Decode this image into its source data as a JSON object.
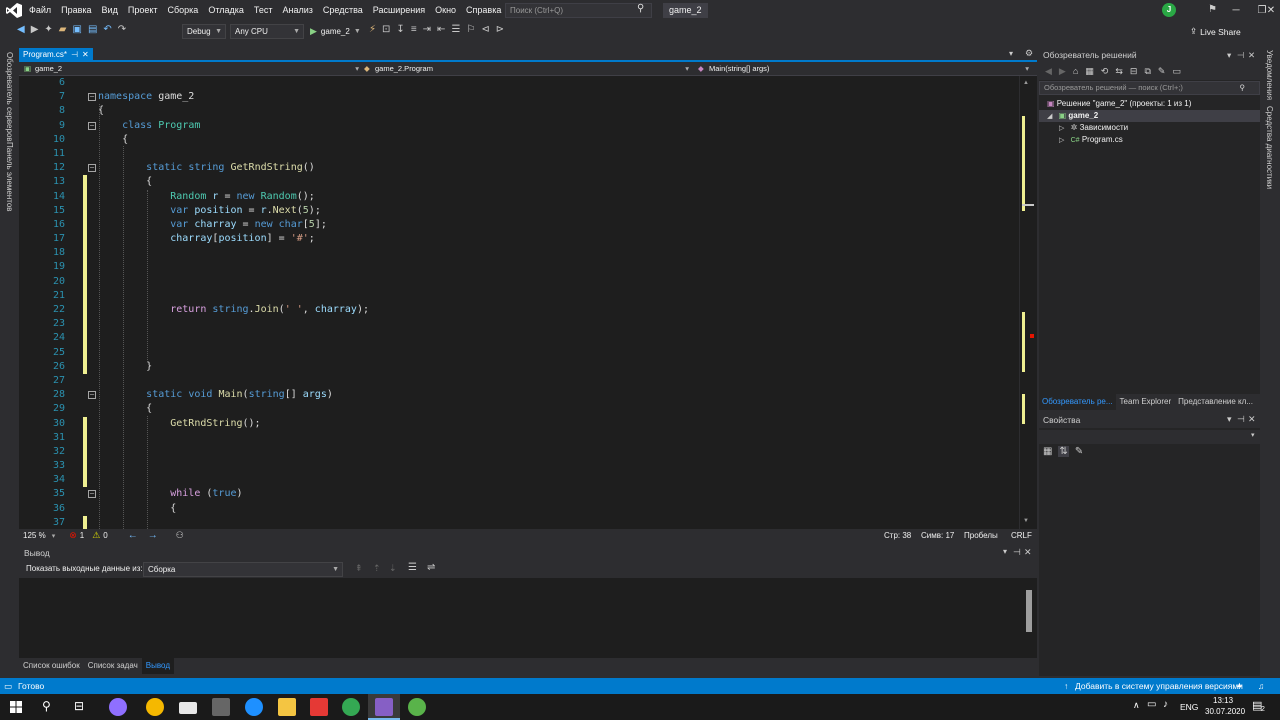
{
  "menu": [
    "Файл",
    "Правка",
    "Вид",
    "Проект",
    "Сборка",
    "Отладка",
    "Тест",
    "Анализ",
    "Средства",
    "Расширения",
    "Окно",
    "Справка"
  ],
  "search": {
    "placeholder": "Поиск (Ctrl+Q)"
  },
  "solution_title": "game_2",
  "user_initial": "J",
  "toolbar": {
    "config": "Debug",
    "platform": "Any CPU",
    "run_label": "game_2",
    "live_share": "Live Share"
  },
  "left_strip": [
    "Обозреватель серверов",
    "Панель элементов"
  ],
  "right_strip": [
    "Уведомления",
    "Средства диагностики"
  ],
  "doc_tab": {
    "label": "Program.cs*",
    "pin": "⊣",
    "close": "✕"
  },
  "navbar": {
    "project": "game_2",
    "class": "game_2.Program",
    "member": "Main(string[] args)"
  },
  "code_lines": [
    {
      "n": "6",
      "t": ""
    },
    {
      "n": "7",
      "t": "<span class='kw'>namespace</span> game_2",
      "fold": true
    },
    {
      "n": "8",
      "t": "{"
    },
    {
      "n": "9",
      "t": "    <span class='kw'>class</span> <span class='ty'>Program</span>",
      "fold": true
    },
    {
      "n": "10",
      "t": "    {"
    },
    {
      "n": "11",
      "t": ""
    },
    {
      "n": "12",
      "t": "        <span class='kw'>static</span> <span class='kw'>string</span> <span class='fn'>GetRndString</span>()",
      "fold": true
    },
    {
      "n": "13",
      "t": "        {",
      "chg": true
    },
    {
      "n": "14",
      "t": "            <span class='ty'>Random</span> <span class='vr'>r</span> = <span class='kw'>new</span> <span class='ty'>Random</span>();",
      "chg": true
    },
    {
      "n": "15",
      "t": "            <span class='kw'>var</span> <span class='vr'>position</span> = <span class='vr'>r</span>.<span class='fn'>Next</span>(<span class='nm'>5</span>);",
      "chg": true
    },
    {
      "n": "16",
      "t": "            <span class='kw'>var</span> <span class='vr'>charray</span> = <span class='kw'>new</span> <span class='kw'>char</span>[<span class='nm'>5</span>];",
      "chg": true
    },
    {
      "n": "17",
      "t": "            <span class='vr'>charray</span>[<span class='vr'>position</span>] = <span class='st'>'#'</span>;",
      "chg": true
    },
    {
      "n": "18",
      "t": "",
      "chg": true
    },
    {
      "n": "19",
      "t": "",
      "chg": true
    },
    {
      "n": "20",
      "t": "",
      "chg": true
    },
    {
      "n": "21",
      "t": "",
      "chg": true
    },
    {
      "n": "22",
      "t": "            <span class='kc'>return</span> <span class='kw'>string</span>.<span class='fn'>Join</span>(<span class='st'>' '</span>, <span class='vr'>charray</span>);",
      "chg": true
    },
    {
      "n": "23",
      "t": "",
      "chg": true
    },
    {
      "n": "24",
      "t": "",
      "chg": true
    },
    {
      "n": "25",
      "t": "",
      "chg": true
    },
    {
      "n": "26",
      "t": "        }",
      "chg": true
    },
    {
      "n": "27",
      "t": ""
    },
    {
      "n": "28",
      "t": "        <span class='kw'>static</span> <span class='kw'>void</span> <span class='fn'>Main</span>(<span class='kw'>string</span>[] <span class='vr'>args</span>)",
      "fold": true
    },
    {
      "n": "29",
      "t": "        {"
    },
    {
      "n": "30",
      "t": "            <span class='fn'>GetRndString</span>();",
      "chg": true
    },
    {
      "n": "31",
      "t": "",
      "chg": true
    },
    {
      "n": "32",
      "t": "",
      "chg": true
    },
    {
      "n": "33",
      "t": "",
      "chg": true
    },
    {
      "n": "34",
      "t": "",
      "chg": true
    },
    {
      "n": "35",
      "t": "            <span class='kc'>while</span> (<span class='kw'>true</span>)",
      "fold": true
    },
    {
      "n": "36",
      "t": "            {"
    },
    {
      "n": "37",
      "t": "",
      "chg": true
    }
  ],
  "editor_status": {
    "zoom": "125 %",
    "errors": "1",
    "warnings": "0",
    "line": "Стр: 38",
    "col": "Симв: 17",
    "spaces": "Пробелы",
    "eol": "CRLF"
  },
  "output": {
    "title": "Вывод",
    "show_label": "Показать выходные данные из:",
    "source": "Сборка"
  },
  "bottom_tabs": [
    "Список ошибок",
    "Список задач",
    "Вывод"
  ],
  "solution_explorer": {
    "title": "Обозреватель решений",
    "search_placeholder": "Обозреватель решений — поиск (Ctrl+;)",
    "solution": "Решение \"game_2\" (проекты: 1 из 1)",
    "project": "game_2",
    "deps": "Зависимости",
    "file": "Program.cs",
    "tabs": [
      "Обозреватель ре...",
      "Team Explorer",
      "Представление кл..."
    ]
  },
  "properties": {
    "title": "Свойства"
  },
  "statusbar": {
    "ready": "Готово",
    "vcs": "Добавить в систему управления версиями"
  },
  "taskbar": {
    "lang": "ENG",
    "time": "13:13",
    "date": "30.07.2020",
    "notif": "2"
  },
  "colors": {
    "accent": "#007acc",
    "editor_bg": "#1e1e1e",
    "chrome": "#2d2d30"
  }
}
